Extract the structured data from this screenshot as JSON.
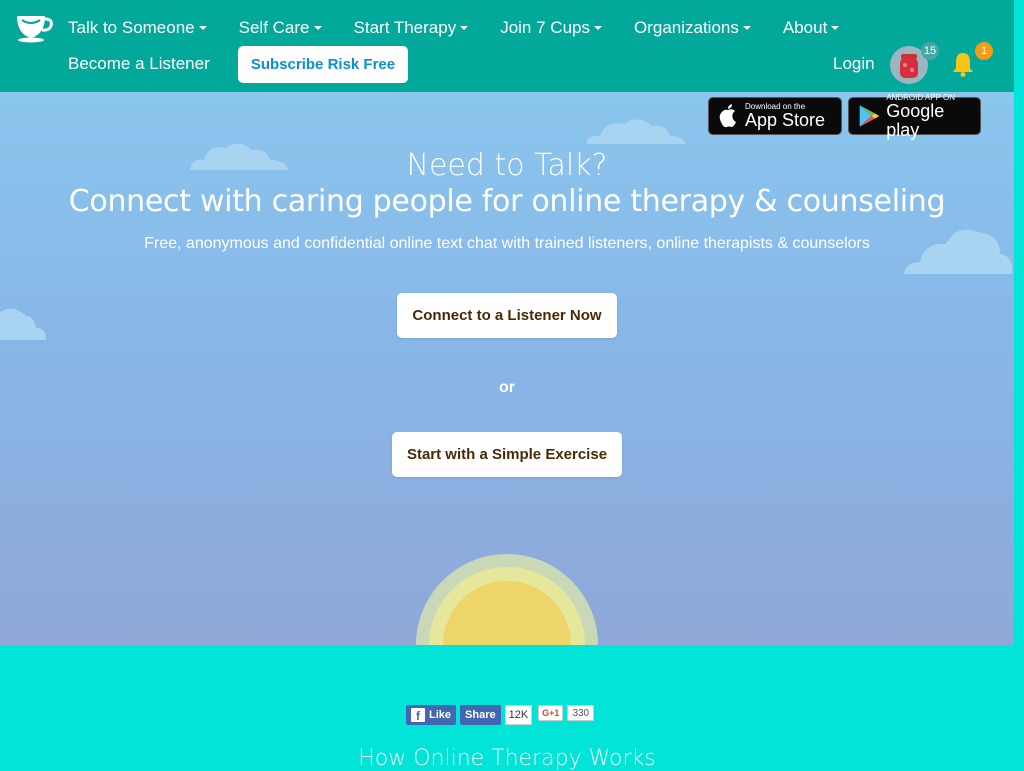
{
  "header": {
    "logo_icon": "teacup-logo-icon",
    "nav": [
      {
        "label": "Talk to Someone"
      },
      {
        "label": "Self Care"
      },
      {
        "label": "Start Therapy"
      },
      {
        "label": "Join 7 Cups"
      },
      {
        "label": "Organizations"
      },
      {
        "label": "About"
      }
    ],
    "become_listener": "Become a Listener",
    "subscribe": "Subscribe Risk Free",
    "login": "Login",
    "avatar_badge": "15",
    "notification_badge": "1"
  },
  "hero": {
    "app_store": {
      "small": "Download on the",
      "big": "App Store"
    },
    "google_play": {
      "small": "ANDROID APP ON",
      "big": "Google play"
    },
    "headline_1": "Need to Talk?",
    "headline_2": "Connect with caring people for online therapy & counseling",
    "subtitle": "Free, anonymous and confidential online text chat with trained listeners, online therapists & counselors",
    "cta_listener": "Connect to a Listener Now",
    "or": "or",
    "cta_exercise": "Start with a Simple Exercise"
  },
  "social": {
    "fb_like": "Like",
    "fb_share": "Share",
    "fb_count": "12K",
    "gplus_label": "G+1",
    "gplus_count": "330"
  },
  "section_title": "How Online Therapy Works",
  "colors": {
    "header": "#02a89a",
    "footer": "#03e4d9",
    "sky_top": "#8ac6ee",
    "sky_bottom": "#8fa8d8",
    "cta_text": "#4a2a05",
    "subscribe_text": "#0b8fd0"
  }
}
